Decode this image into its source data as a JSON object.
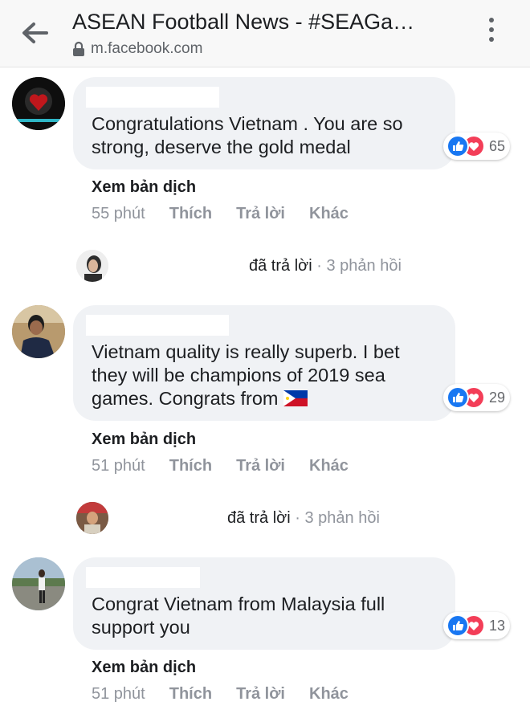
{
  "header": {
    "title": "ASEAN Football News - #SEAGa…",
    "url": "m.facebook.com"
  },
  "comments": [
    {
      "text_lines": [
        "Congratulations Vietnam . You are so",
        "strong, deserve the gold medal"
      ],
      "reaction_count": "65",
      "translate": "Xem bản dịch",
      "time": "55 phút",
      "like": "Thích",
      "reply": "Trả lời",
      "more": "Khác",
      "replied": "đã trả lời",
      "separator": " · ",
      "reply_count": "3 phản hồi"
    },
    {
      "text_lines": [
        "Vietnam quality is really superb. I bet",
        "they will be champions of 2019 sea",
        "games. Congrats from"
      ],
      "flag": "philippines-flag",
      "reaction_count": "29",
      "translate": "Xem bản dịch",
      "time": "51 phút",
      "like": "Thích",
      "reply": "Trả lời",
      "more": "Khác",
      "replied": "đã trả lời",
      "separator": " · ",
      "reply_count": "3 phản hồi"
    },
    {
      "text_lines": [
        "Congrat Vietnam from Malaysia full",
        "support you"
      ],
      "reaction_count": "13",
      "translate": "Xem bản dịch",
      "time": "51 phút",
      "like": "Thích",
      "reply": "Trả lời",
      "more": "Khác"
    }
  ],
  "colors": {
    "like_blue": "#1877f2",
    "love_red": "#f33e58",
    "bubble": "#f0f2f5",
    "muted_text": "#90949c"
  }
}
